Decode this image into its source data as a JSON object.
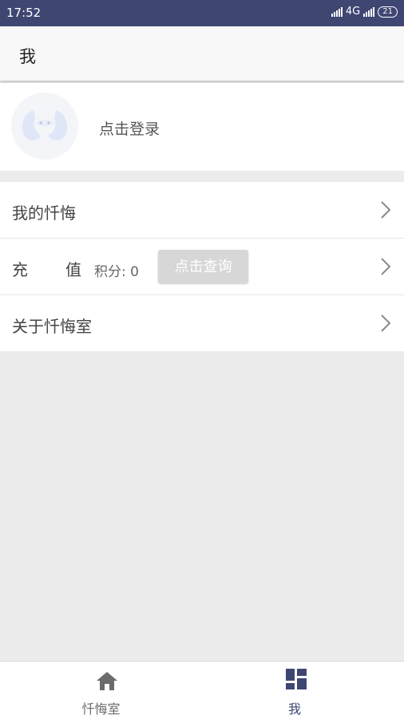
{
  "status_bar": {
    "time": "17:52",
    "network": "4G",
    "battery": "21"
  },
  "app_bar": {
    "title": "我"
  },
  "login": {
    "prompt": "点击登录"
  },
  "menu": {
    "my_confessions": "我的忏悔",
    "recharge_char1": "充",
    "recharge_char2": "值",
    "points_label": "积分: 0",
    "query_button": "点击查询",
    "about": "关于忏悔室"
  },
  "bottom_nav": {
    "tabs": [
      {
        "label": "忏悔室",
        "icon": "home-icon",
        "active": false
      },
      {
        "label": "我",
        "icon": "dashboard-icon",
        "active": true
      }
    ]
  },
  "colors": {
    "status_bar": "#3f4672",
    "active_tab": "#3f4672",
    "inactive_tab": "#6b6b6b",
    "background": "#ececec"
  }
}
